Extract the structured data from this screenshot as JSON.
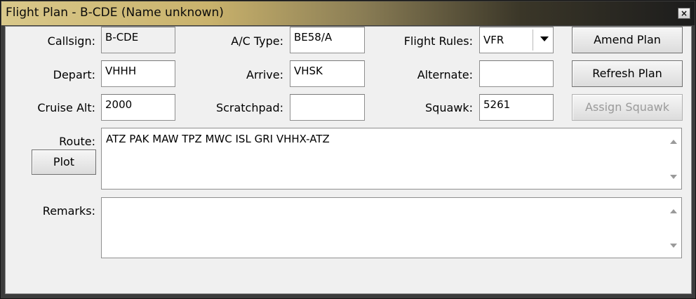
{
  "window": {
    "title": "Flight Plan - B-CDE (Name unknown)",
    "close_glyph": "×"
  },
  "form": {
    "callsign_label": "Callsign:",
    "callsign_value": "B-CDE",
    "actype_label": "A/C Type:",
    "actype_value": "BE58/A",
    "flight_rules_label": "Flight Rules:",
    "flight_rules_value": "VFR",
    "depart_label": "Depart:",
    "depart_value": "VHHH",
    "arrive_label": "Arrive:",
    "arrive_value": "VHSK",
    "alternate_label": "Alternate:",
    "alternate_value": "",
    "cruise_label": "Cruise Alt:",
    "cruise_value": "2000",
    "scratchpad_label": "Scratchpad:",
    "scratchpad_value": "",
    "squawk_label": "Squawk:",
    "squawk_value": "5261",
    "route_label": "Route:",
    "route_value": "ATZ PAK MAW TPZ MWC ISL GRI VHHX-ATZ",
    "remarks_label": "Remarks:",
    "remarks_value": ""
  },
  "buttons": {
    "amend": "Amend Plan",
    "refresh": "Refresh Plan",
    "assign_squawk": "Assign Squawk",
    "plot": "Plot"
  },
  "icons": {
    "close": "close-icon",
    "dropdown": "chevron-down-icon",
    "scroll_up": "scroll-up-icon",
    "scroll_down": "scroll-down-icon"
  }
}
